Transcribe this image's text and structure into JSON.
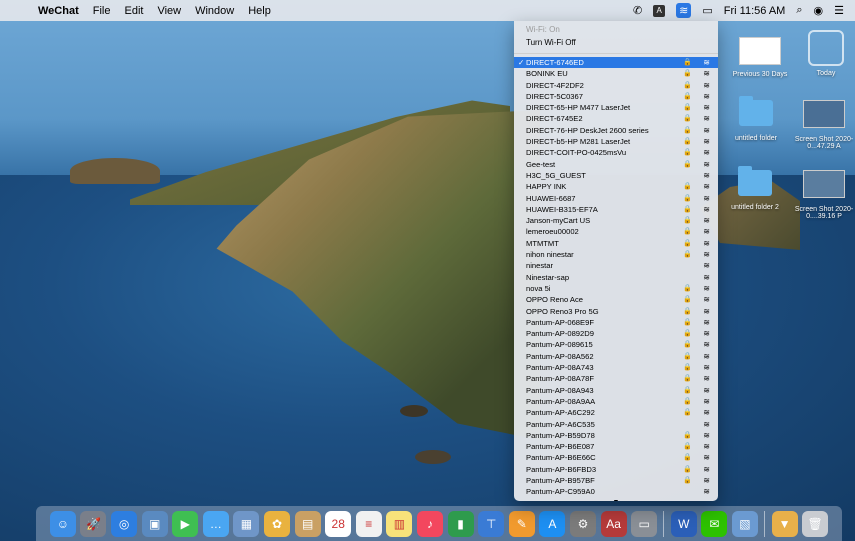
{
  "menubar": {
    "app_name": "WeChat",
    "menus": [
      "File",
      "Edit",
      "View",
      "Window",
      "Help"
    ],
    "clock": "Fri 11:56 AM"
  },
  "desktop": {
    "items": [
      {
        "label": "Previous 30 Days"
      },
      {
        "label": "Today"
      },
      {
        "label": "untitled folder"
      },
      {
        "label": "Screen Shot 2020-0...47.29 A"
      },
      {
        "label": "untitled folder 2"
      },
      {
        "label": "Screen Shot 2020-0....39.16 P"
      }
    ]
  },
  "wifi_menu": {
    "status": "Wi-Fi: On",
    "toggle_label": "Turn Wi-Fi Off",
    "networks": [
      {
        "name": "DIRECT-6746ED",
        "locked": true,
        "selected": true
      },
      {
        "name": "BONINK EU",
        "locked": true
      },
      {
        "name": "DIRECT-4F2DF2",
        "locked": true
      },
      {
        "name": "DIRECT-5C0367",
        "locked": true
      },
      {
        "name": "DIRECT-65-HP M477 LaserJet",
        "locked": true
      },
      {
        "name": "DIRECT-6745E2",
        "locked": true
      },
      {
        "name": "DIRECT-76-HP DeskJet 2600 series",
        "locked": true
      },
      {
        "name": "DIRECT-b5-HP M281 LaserJet",
        "locked": true
      },
      {
        "name": "DIRECT-COIT-PO-0425msVu",
        "locked": true
      },
      {
        "name": "Gee-test",
        "locked": true
      },
      {
        "name": "H3C_5G_GUEST",
        "locked": false
      },
      {
        "name": "HAPPY INK",
        "locked": true
      },
      {
        "name": "HUAWEI-6687",
        "locked": true
      },
      {
        "name": "HUAWEI-B315-EF7A",
        "locked": true
      },
      {
        "name": "Janson-myCart US",
        "locked": true
      },
      {
        "name": "lemeroeu00002",
        "locked": true
      },
      {
        "name": "MTMTMT",
        "locked": true
      },
      {
        "name": "nihon ninestar",
        "locked": true
      },
      {
        "name": "ninestar",
        "locked": false
      },
      {
        "name": "Ninestar-sap",
        "locked": false
      },
      {
        "name": "nova 5i",
        "locked": true
      },
      {
        "name": "OPPO Reno Ace",
        "locked": true
      },
      {
        "name": "OPPO Reno3 Pro 5G",
        "locked": true
      },
      {
        "name": "Pantum-AP-068E9F",
        "locked": true
      },
      {
        "name": "Pantum-AP-0892D9",
        "locked": true
      },
      {
        "name": "Pantum-AP-089615",
        "locked": true
      },
      {
        "name": "Pantum-AP-08A562",
        "locked": true
      },
      {
        "name": "Pantum-AP-08A743",
        "locked": true
      },
      {
        "name": "Pantum-AP-08A78F",
        "locked": true
      },
      {
        "name": "Pantum-AP-08A943",
        "locked": true
      },
      {
        "name": "Pantum-AP-08A9AA",
        "locked": true
      },
      {
        "name": "Pantum-AP-A6C292",
        "locked": true
      },
      {
        "name": "Pantum-AP-A6C535",
        "locked": false
      },
      {
        "name": "Pantum-AP-B59D78",
        "locked": true
      },
      {
        "name": "Pantum-AP-B6E087",
        "locked": true
      },
      {
        "name": "Pantum-AP-B6E66C",
        "locked": true
      },
      {
        "name": "Pantum-AP-B6FBD3",
        "locked": true
      },
      {
        "name": "Pantum-AP-B957BF",
        "locked": true
      },
      {
        "name": "Pantum-AP-C959A0",
        "locked": false
      }
    ],
    "more_arrow": "▼"
  },
  "dock": {
    "apps": [
      {
        "icon": "finder-icon",
        "color": "#3d8fe6",
        "glyph": "☺"
      },
      {
        "icon": "launchpad-icon",
        "color": "#7a7f8a",
        "glyph": "🚀"
      },
      {
        "icon": "safari-icon",
        "color": "#2d7ee0",
        "glyph": "◎"
      },
      {
        "icon": "preview-icon",
        "color": "#5a8ac0",
        "glyph": "▣"
      },
      {
        "icon": "facetime-icon",
        "color": "#3fbf52",
        "glyph": "▶"
      },
      {
        "icon": "messages-icon",
        "color": "#4aa6f2",
        "glyph": "…"
      },
      {
        "icon": "photo-booth-icon",
        "color": "#6f96c8",
        "glyph": "▦"
      },
      {
        "icon": "photos-icon",
        "color": "#e9b23f",
        "glyph": "✿"
      },
      {
        "icon": "contacts-icon",
        "color": "#c9a064",
        "glyph": "▤"
      },
      {
        "icon": "calendar-icon",
        "color": "#ffffff",
        "glyph": "28"
      },
      {
        "icon": "reminders-icon",
        "color": "#f1f1f1",
        "glyph": "≡"
      },
      {
        "icon": "notes-icon",
        "color": "#f7e27a",
        "glyph": "▥"
      },
      {
        "icon": "music-icon",
        "color": "#f3475e",
        "glyph": "♪"
      },
      {
        "icon": "numbers-icon",
        "color": "#2e9b4d",
        "glyph": "▮"
      },
      {
        "icon": "keynote-icon",
        "color": "#3a7bd5",
        "glyph": "⊤"
      },
      {
        "icon": "pages-icon",
        "color": "#f19a2e",
        "glyph": "✎"
      },
      {
        "icon": "app-store-icon",
        "color": "#1d8ff2",
        "glyph": "A"
      },
      {
        "icon": "system-preferences-icon",
        "color": "#7b7b7b",
        "glyph": "⚙"
      },
      {
        "icon": "dictionary-icon",
        "color": "#b53a3a",
        "glyph": "Aa"
      },
      {
        "icon": "printer-icon",
        "color": "#8a8f96",
        "glyph": "▭"
      },
      {
        "icon": "word-icon",
        "color": "#2b5fb8",
        "glyph": "W"
      },
      {
        "icon": "wechat-icon",
        "color": "#2dc100",
        "glyph": "✉"
      },
      {
        "icon": "screenshot-icon",
        "color": "#6b9ad1",
        "glyph": "▧"
      },
      {
        "icon": "downloads-icon",
        "color": "#e8b04a",
        "glyph": "▼"
      },
      {
        "icon": "trash-icon",
        "color": "#c9ccd1",
        "glyph": "🗑"
      }
    ]
  }
}
